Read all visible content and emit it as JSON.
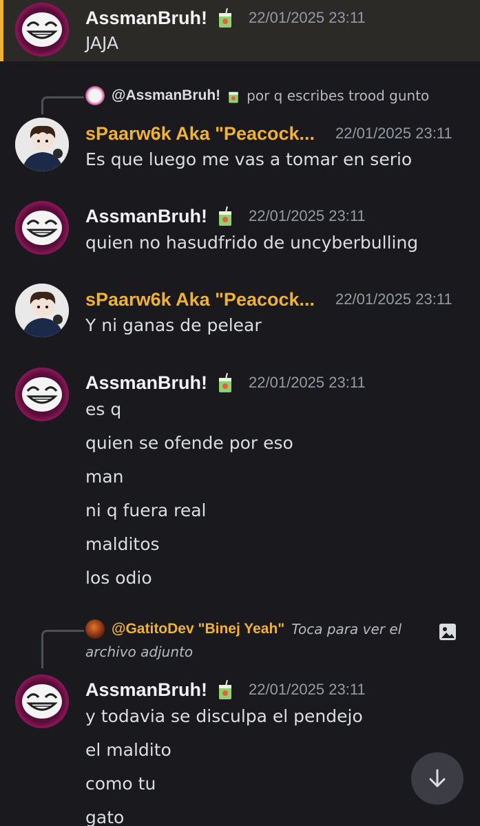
{
  "colors": {
    "background": "#1a1a1e",
    "highlight_bg": "#2b2a26",
    "highlight_bar": "#f0b232",
    "gold_name": "#f0b232",
    "timestamp": "#949ba4"
  },
  "messages": [
    {
      "author": "AssmanBruh!",
      "badge": "juice-box-icon",
      "timestamp": "22/01/2025 23:11",
      "lines": [
        "JAJA"
      ]
    },
    {
      "reply": {
        "name": "@AssmanBruh!",
        "text": "por q escribes trood gunto"
      },
      "author": "sPaarw6k Aka \"Peacock...",
      "timestamp": "22/01/2025 23:11",
      "lines": [
        "Es que luego me vas a tomar en serio"
      ]
    },
    {
      "author": "AssmanBruh!",
      "timestamp": "22/01/2025 23:11",
      "lines": [
        "quien no hasudfrido de uncyberbulling"
      ]
    },
    {
      "author": "sPaarw6k Aka \"Peacock...",
      "timestamp": "22/01/2025 23:11",
      "lines": [
        "Y ni ganas de pelear"
      ]
    },
    {
      "author": "AssmanBruh!",
      "timestamp": "22/01/2025 23:11",
      "lines": [
        "es q",
        "quien se ofende por eso",
        "man",
        "ni q fuera real",
        "malditos",
        "los odio"
      ]
    },
    {
      "reply": {
        "name": "@GatitoDev \"Binej Yeah\"",
        "text_1": "Toca para ver el",
        "text_2": "archivo adjunto"
      },
      "author": "AssmanBruh!",
      "timestamp": "22/01/2025 23:11",
      "lines": [
        "y todavia se disculpa el pendejo",
        "el maldito",
        "como tu",
        "gato"
      ]
    }
  ],
  "scroll_button": {
    "icon": "arrow-down-icon"
  }
}
